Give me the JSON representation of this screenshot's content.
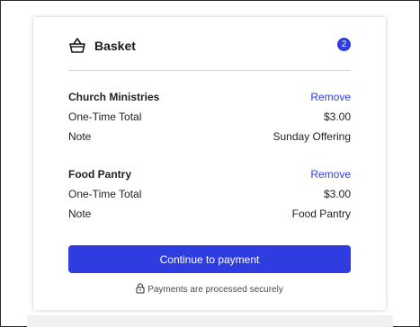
{
  "basket": {
    "title": "Basket",
    "count": "2",
    "items": [
      {
        "name": "Church Ministries",
        "remove_label": "Remove",
        "total_label": "One-Time Total",
        "total_value": "$3.00",
        "note_label": "Note",
        "note_value": "Sunday Offering"
      },
      {
        "name": "Food Pantry",
        "remove_label": "Remove",
        "total_label": "One-Time Total",
        "total_value": "$3.00",
        "note_label": "Note",
        "note_value": "Food Pantry"
      }
    ],
    "continue_label": "Continue to payment",
    "secure_text": "Payments are processed securely"
  },
  "colors": {
    "accent": "#2f3de0",
    "text": "#1f1f1f",
    "divider": "#d6d6d6"
  },
  "icons": {
    "header": "basket-icon",
    "secure": "lock-icon"
  }
}
